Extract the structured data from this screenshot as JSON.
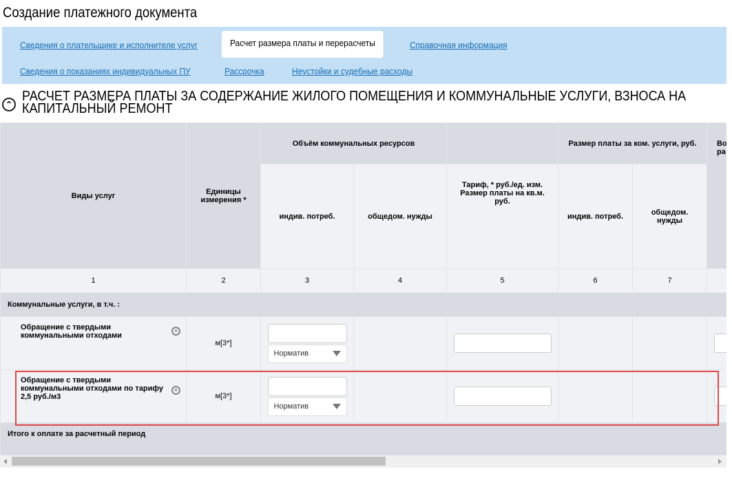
{
  "page_title": "Создание платежного документа",
  "tabs": [
    {
      "label": "Сведения о плательщике и исполнителе услуг",
      "active": false
    },
    {
      "label": "Расчет размера платы и перерасчеты",
      "active": true
    },
    {
      "label": "Справочная информация",
      "active": false
    },
    {
      "label": "Сведения о показаниях индивидуальных ПУ",
      "active": false
    },
    {
      "label": "Рассрочка",
      "active": false
    },
    {
      "label": "Неустойки и судебные расходы",
      "active": false
    }
  ],
  "section_title": "РАСЧЕТ РАЗМЕРА ПЛАТЫ ЗА СОДЕРЖАНИЕ ЖИЛОГО ПОМЕЩЕНИЯ И КОММУНАЛЬНЫЕ УСЛУГИ, ВЗНОСА НА КАПИТАЛЬНЫЙ РЕМОНТ",
  "table": {
    "group_volume": "Объём коммунальных ресурсов",
    "group_payment": "Размер платы за ком. услуги, руб.",
    "headers": {
      "service": "Виды услуг",
      "unit": "Единицы измерения *",
      "vol_ind": "индив. потреб.",
      "vol_common": "общедом. нужды",
      "tariff": "Тариф, * руб./ед. изм. Размер платы на кв.м. руб.",
      "pay_ind": "индив. потреб.",
      "pay_common": "общедом. нужды",
      "col8_line1": "Во",
      "col8_line2": "ра"
    },
    "col_numbers": [
      "1",
      "2",
      "3",
      "4",
      "5",
      "6",
      "7"
    ],
    "group_row": "Коммунальные услуги, в т.ч. :",
    "rows": [
      {
        "service": "Обращение с твердыми коммунальными отходами",
        "unit": "м[3*]",
        "volume_value": "",
        "method": "Норматив",
        "tariff_value": ""
      },
      {
        "service": "Обращение с твердыми коммунальными отходами по тарифу 2,5 руб./м3",
        "unit": "м[3*]",
        "volume_value": "",
        "method": "Норматив",
        "tariff_value": "",
        "highlighted": true
      }
    ],
    "total_row": "Итого к оплате за расчетный период"
  },
  "colors": {
    "tabs_bg": "#c2dff5",
    "link": "#1a6fb5",
    "highlight": "#e04848"
  }
}
